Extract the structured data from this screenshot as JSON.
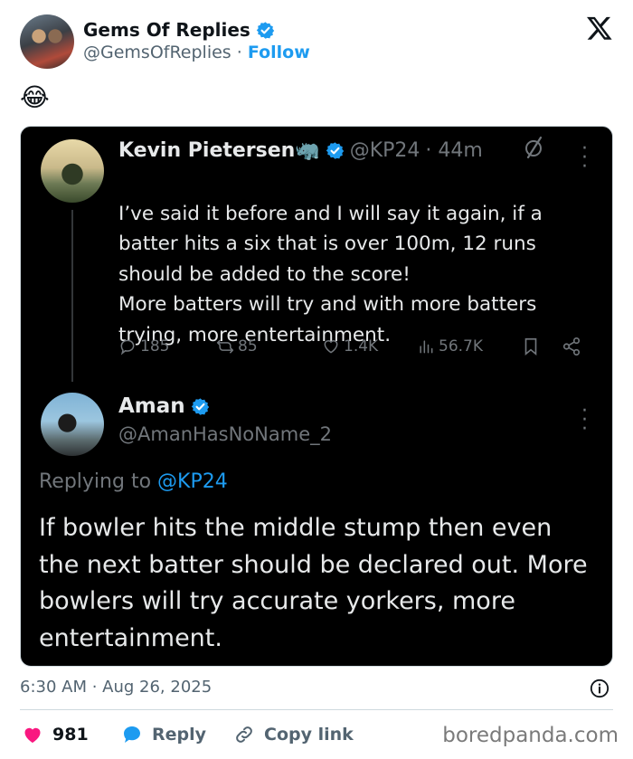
{
  "post": {
    "author_name": "Gems Of Replies",
    "handle": "@GemsOfReplies",
    "separator": "·",
    "follow_label": "Follow",
    "emoji": "😂",
    "timestamp": "6:30 AM · Aug 26, 2025",
    "likes": "981",
    "reply_label": "Reply",
    "copy_link_label": "Copy link"
  },
  "embedded": {
    "original": {
      "name": "Kevin Pietersen🦏",
      "handle": "@KP24",
      "age": "· 44m",
      "text": "I’ve said it before and I will say it again, if a batter hits a six that is over 100m, 12 runs should be added to the score!\nMore batters will try and with more batters trying, more entertainment.",
      "replies": "185",
      "reposts": "85",
      "likes": "1.4K",
      "views": "56.7K"
    },
    "reply": {
      "name": "Aman",
      "handle": "@AmanHasNoName_2",
      "replying_prefix": "Replying to",
      "replying_mention": "@KP24",
      "text": "If bowler hits the middle stump then even the next batter should be declared out. More bowlers will try accurate yorkers, more entertainment."
    }
  },
  "watermark": "boredpanda.com",
  "colors": {
    "accent": "#1d9bf0",
    "heart": "#f91880",
    "dark_bg": "#000000"
  }
}
